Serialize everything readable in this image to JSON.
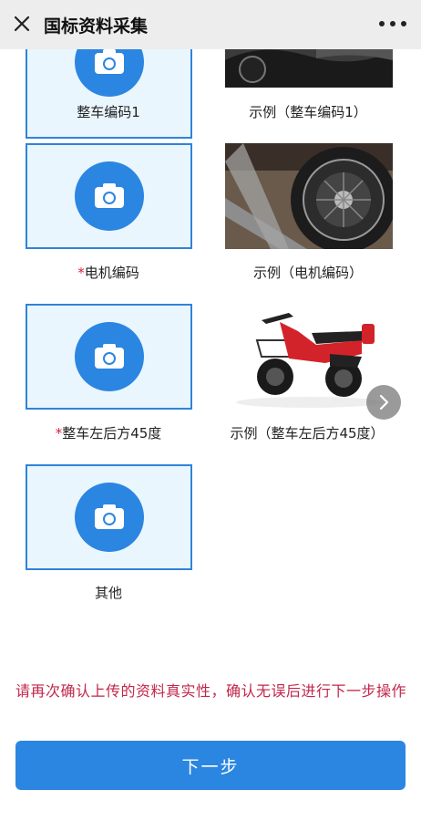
{
  "header": {
    "title": "国标资料采集"
  },
  "uploads": [
    {
      "label": "整车编码1",
      "required": false,
      "sample_label": "示例（整车编码1）"
    },
    {
      "label": "电机编码",
      "required": true,
      "sample_label": "示例（电机编码）"
    },
    {
      "label": "整车左后方45度",
      "required": true,
      "sample_label": "示例（整车左后方45度）"
    },
    {
      "label": "其他",
      "required": false
    }
  ],
  "required_mark": "*",
  "warning_text": "请再次确认上传的资料真实性，确认无误后进行下一步操作",
  "next_button_label": "下一步",
  "colors": {
    "accent": "#2b86e1",
    "required": "#d81e3e",
    "warning": "#c2264a",
    "upload_bg": "#eaf6fe"
  }
}
